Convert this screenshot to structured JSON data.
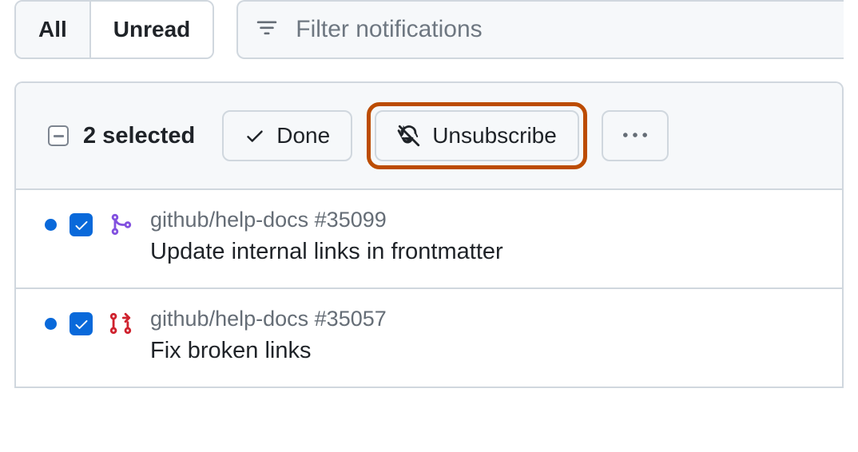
{
  "tabs": {
    "all": "All",
    "unread": "Unread"
  },
  "filter": {
    "placeholder": "Filter notifications"
  },
  "actionbar": {
    "selected_label": "2 selected",
    "done_label": "Done",
    "unsubscribe_label": "Unsubscribe"
  },
  "notifications": [
    {
      "repo": "github/help-docs",
      "number": "#35099",
      "title": "Update internal links in frontmatter",
      "type": "merged-pr"
    },
    {
      "repo": "github/help-docs",
      "number": "#35057",
      "title": "Fix broken links",
      "type": "open-pr"
    }
  ]
}
